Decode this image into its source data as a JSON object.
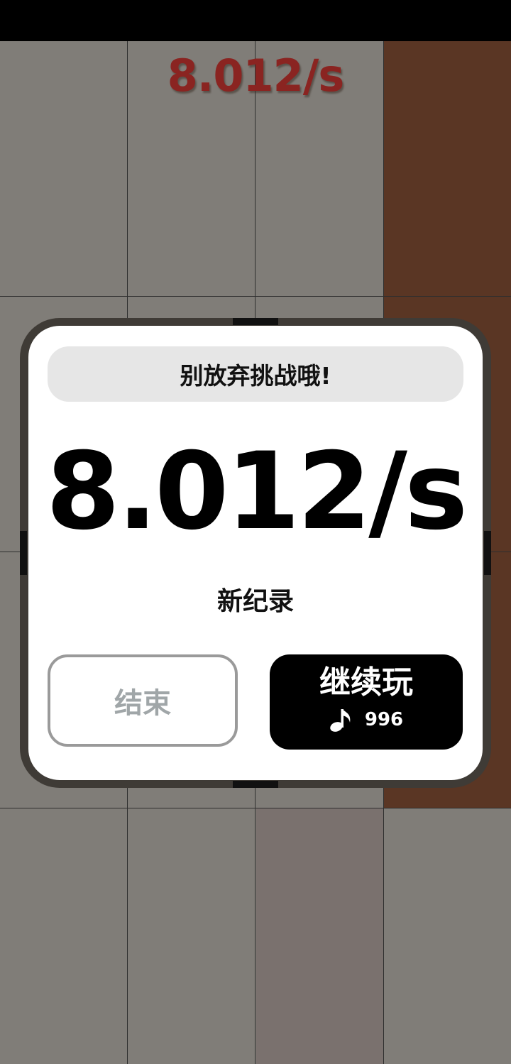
{
  "game": {
    "top_timer": "8.012/s",
    "tile_colors": {
      "board": "#807d78",
      "dark_tile": "#5a3624",
      "light_tile": "#7a716e",
      "grid_line": "#2e2e2e"
    }
  },
  "dialog": {
    "banner": "别放弃挑战哦!",
    "score": "8.012/s",
    "record_label": "新纪录",
    "end_button": "结束",
    "continue_button": "继续玩",
    "continue_cost": "996",
    "cost_icon": "music-note-icon"
  }
}
